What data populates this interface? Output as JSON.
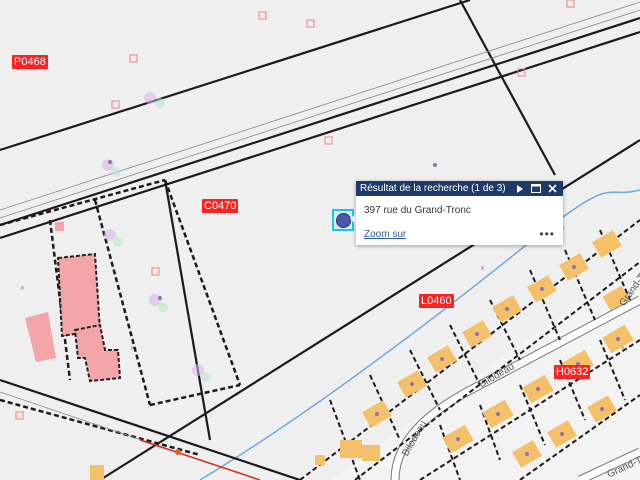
{
  "map": {
    "zone_labels": [
      "P0468",
      "C0470",
      "L0460",
      "H0632"
    ],
    "road_labels": [
      "Bilodeau",
      "Bilodeau",
      "Grand-T",
      "Grand-Tr"
    ],
    "colors": {
      "background": "#efefef",
      "zone_label": "#ff2020",
      "building_fill": "#f5c06a",
      "pink_building": "#f4a5a8",
      "lot_lines": "#222222",
      "water_line": "#6fa8dc",
      "selection": "#22c5e0",
      "popup_header": "#1f3a68"
    }
  },
  "popup": {
    "title": "Résultat de la recherche (1 de 3)",
    "address": "397 rue du Grand-Tronc",
    "zoom_link": "Zoom sur",
    "more": "•••",
    "icons": [
      "next-arrow-icon",
      "maximize-icon",
      "close-icon"
    ]
  },
  "marker": {
    "icon": "search-result-marker"
  }
}
